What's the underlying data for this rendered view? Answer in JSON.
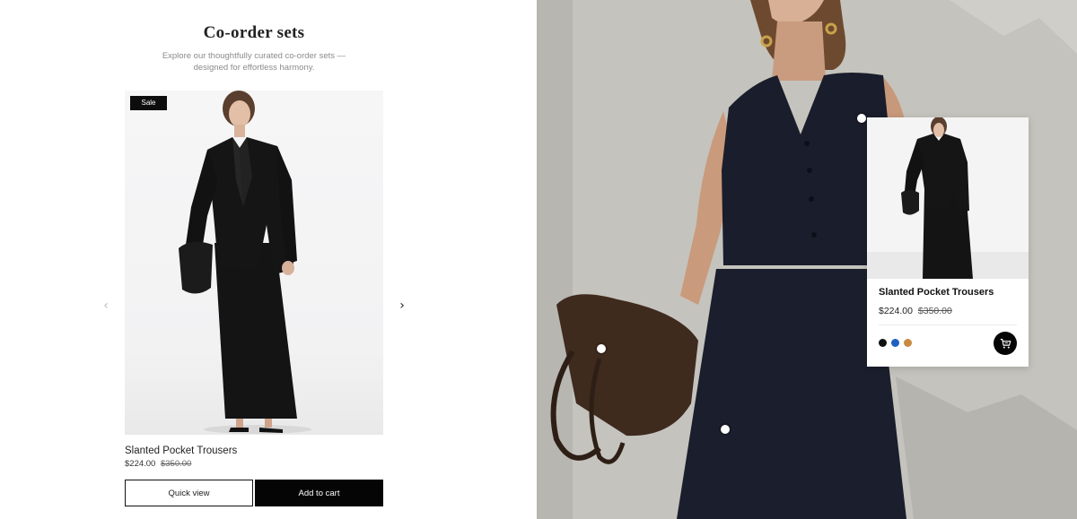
{
  "section": {
    "title": "Co-order sets",
    "subtitle": "Explore our thoughtfully curated co-order sets — designed for effortless harmony."
  },
  "carousel": {
    "prev_icon": "chevron-left-icon",
    "next_icon": "chevron-right-icon",
    "product": {
      "badge": "Sale",
      "name": "Slanted Pocket Trousers",
      "price": "$224.00",
      "compare_price": "$350.00",
      "quick_view_label": "Quick view",
      "add_to_cart_label": "Add to cart"
    }
  },
  "lookbook": {
    "hotspots": 3,
    "popup": {
      "name": "Slanted Pocket Trousers",
      "price": "$224.00",
      "compare_price": "$350.00",
      "swatches": [
        "#111111",
        "#1f5fbf",
        "#c98a3f"
      ],
      "cart_icon": "cart-icon"
    }
  }
}
